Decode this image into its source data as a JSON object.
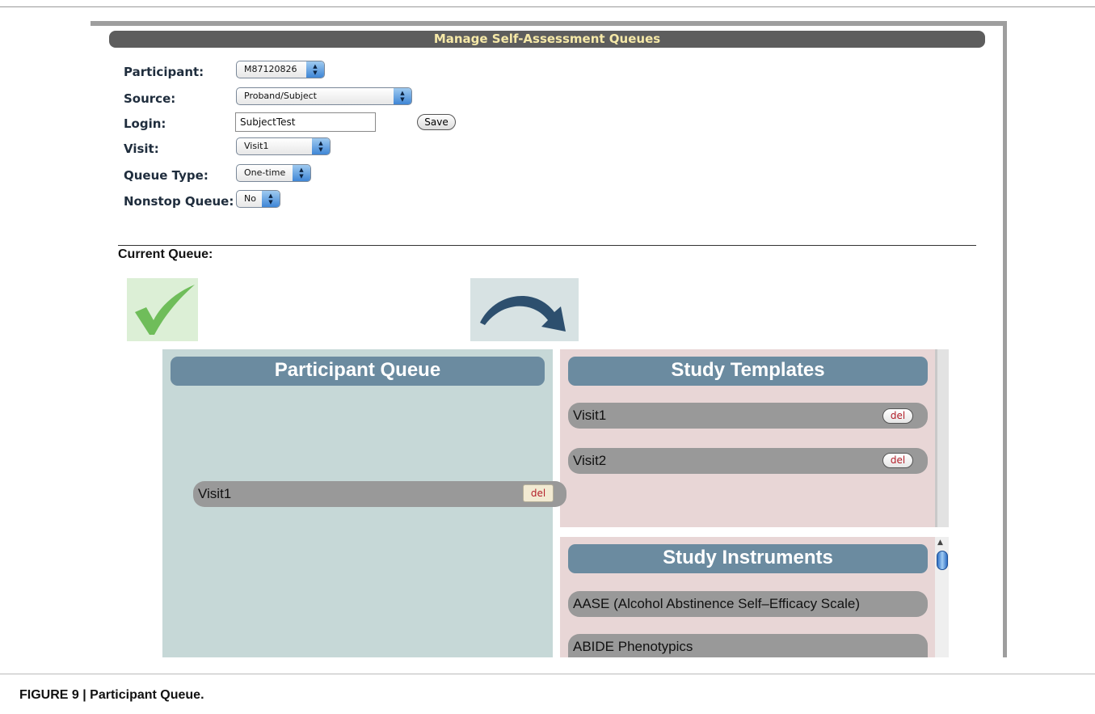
{
  "window_title": "Manage Self-Assessment Queues",
  "form": {
    "participant_label": "Participant:",
    "participant_value": "M87120826",
    "source_label": "Source:",
    "source_value": "Proband/Subject",
    "login_label": "Login:",
    "login_value": "SubjectTest",
    "save_label": "Save",
    "visit_label": "Visit:",
    "visit_value": "Visit1",
    "queue_type_label": "Queue Type:",
    "queue_type_value": "One-time",
    "nonstop_label": "Nonstop Queue:",
    "nonstop_value": "No"
  },
  "current_queue_label": "Current Queue:",
  "icons": {
    "check": "checkmark-icon",
    "arrow": "curved-arrow-icon"
  },
  "participant_queue": {
    "title": "Participant Queue",
    "items": [
      {
        "label": "Visit1",
        "del": "del"
      }
    ]
  },
  "study_templates": {
    "title": "Study Templates",
    "items": [
      {
        "label": "Visit1",
        "del": "del"
      },
      {
        "label": "Visit2",
        "del": "del"
      }
    ]
  },
  "study_instruments": {
    "title": "Study Instruments",
    "items": [
      {
        "label": "AASE (Alcohol Abstinence Self–Efficacy Scale)"
      },
      {
        "label": "ABIDE Phenotypics"
      }
    ]
  },
  "caption": "FIGURE 9 | Participant Queue.",
  "colors": {
    "title_bar": "#5d5d5d",
    "title_text": "#f6e9a8",
    "participant_panel": "#c6d8d7",
    "template_panel": "#e8d6d6",
    "panel_header": "#6b8ba0",
    "item_bg": "#999999",
    "del_text": "#b3202a"
  }
}
